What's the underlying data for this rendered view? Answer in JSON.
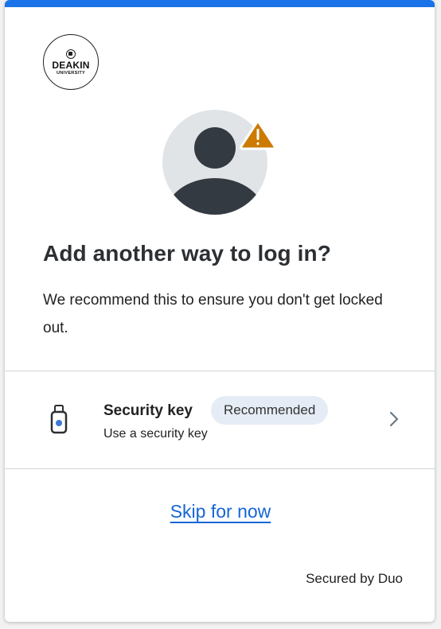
{
  "brand": {
    "logo_line1": "DEAKIN",
    "logo_line2": "UNIVERSITY",
    "accent_color": "#1a73e8",
    "warning_color": "#cc7a00"
  },
  "icons": {
    "avatar": "user-avatar-icon",
    "warning": "warning-triangle-icon",
    "security_key": "security-key-icon",
    "chevron": "chevron-right-icon"
  },
  "main": {
    "title": "Add another way to log in?",
    "description": "We recommend this to ensure you don't get locked out."
  },
  "option": {
    "title": "Security key",
    "badge": "Recommended",
    "subtitle": "Use a security key"
  },
  "actions": {
    "skip_label": "Skip for now"
  },
  "footer": {
    "text": "Secured by Duo"
  }
}
